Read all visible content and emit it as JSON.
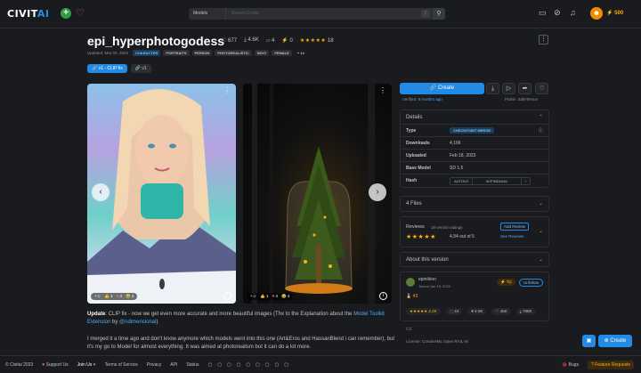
{
  "header": {
    "logo": {
      "civit": "CIVIT",
      "ai": "AI"
    },
    "search_category": "Models",
    "search_placeholder": "Search Civitai",
    "search_shortcut": "/",
    "buzz": "500"
  },
  "model": {
    "title": "epi_hyperphotogodess",
    "likes": "677",
    "downloads": "4.6K",
    "comments": "4",
    "tips": "0",
    "rating_stars": "★★★★★",
    "rating_count": "18",
    "updated": "Updated: Mar 03, 2023",
    "tags": [
      "CHARACTER",
      "PORTRAITS",
      "PERSON",
      "PHOTOREALISTIC",
      "SEXY",
      "FEMALE"
    ],
    "more_tags": "+ 14",
    "versions": [
      {
        "label": "v1 - CLIP fix",
        "active": true
      },
      {
        "label": "v1",
        "active": false
      }
    ]
  },
  "images": [
    {
      "likes": "1",
      "hearts": "4",
      "laughs": "4"
    },
    {
      "likes": "1",
      "hearts": "4",
      "laughs": "4"
    }
  ],
  "description": {
    "bold": "Update",
    "p1": ": CLIP fix - now we get even more accurate and more beautiful images (Thx to the Explanation about the ",
    "link1": "Model Toolkit Extension",
    "p1b": " by ",
    "link2": "@ndimensional",
    "p1c": ")",
    "p2": "I merged it a time ago and don't know anymore which models went into this one (Art&Eros and HassanBlend i can remember), but it's my go to Model for almost everything. It was aimed at photorealism but it can do a lot more."
  },
  "sidebar": {
    "create_label": "Create",
    "verified_prefix": "Verified: ",
    "verified_link": "8 months ago",
    "safetensor": "Pickle: SafeTensor",
    "details": {
      "title": "Details",
      "rows": [
        {
          "k": "Type",
          "v": "CHECKPOINT MERGE"
        },
        {
          "k": "Downloads",
          "v": "4,166"
        },
        {
          "k": "Uploaded",
          "v": "Feb 18, 2023"
        },
        {
          "k": "Base Model",
          "v": "SD 1.5"
        },
        {
          "k": "Hash",
          "v1": "AUTOV2",
          "v2": "0CF30D1A01"
        }
      ]
    },
    "files": "4 Files",
    "reviews": {
      "title": "Reviews",
      "count": "18 version ratings",
      "stars": "★★★★★",
      "score": "4.94 out of 5",
      "add": "Add Review",
      "see": "See Reviews"
    },
    "about": "About this version",
    "creator": {
      "name": "epinikion",
      "joined": "Joined Jan 19, 2023",
      "rank": "#3",
      "tip": "Tip",
      "follow": "Unfollow",
      "stats": [
        "★★★★★ 2.4K",
        "44",
        "4.0K",
        "45K",
        "785K"
      ]
    },
    "license": "License: CreativeML Open RAIL-M"
  },
  "footer": {
    "copyright": "© Civitai 2023",
    "support": "Support Us",
    "join": "Join Us",
    "terms": "Terms of Service",
    "privacy": "Privacy",
    "api": "API",
    "status": "Status",
    "bugs": "Bugs",
    "feature": "Feature Requests"
  },
  "fab_create": "Create"
}
